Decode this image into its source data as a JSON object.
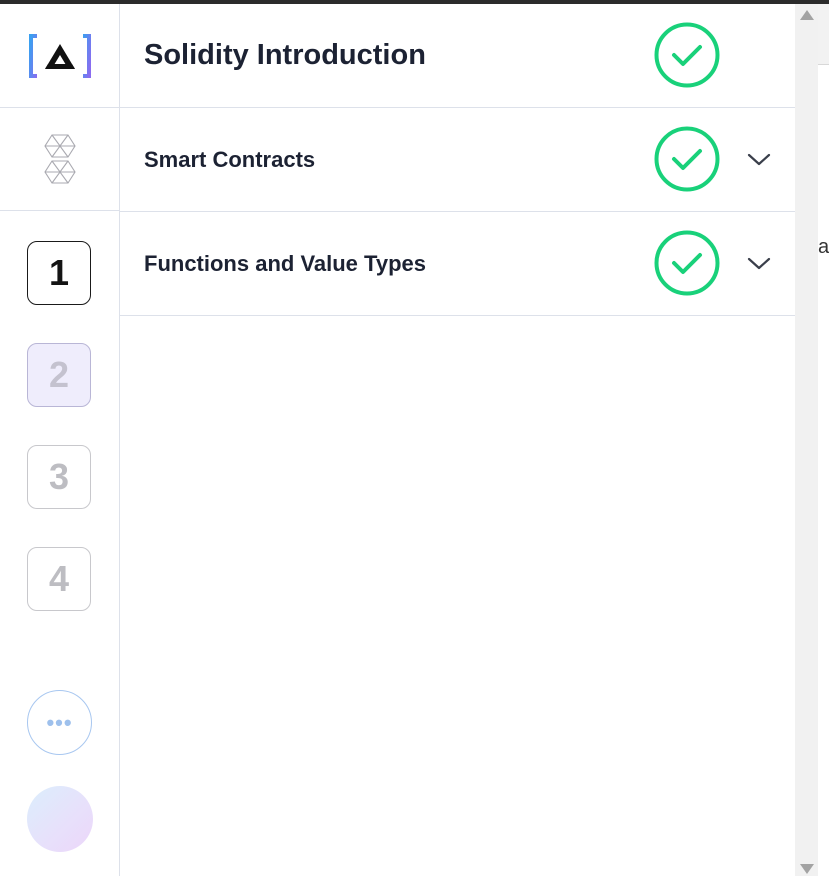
{
  "app": {
    "logo_icon": "alchemy-bracket-logo",
    "hex_icon": "hexagon-triangles-icon"
  },
  "steps": [
    {
      "label": "1",
      "state": "active"
    },
    {
      "label": "2",
      "state": "current"
    },
    {
      "label": "3",
      "state": "inactive"
    },
    {
      "label": "4",
      "state": "inactive"
    }
  ],
  "more_button": {
    "label": "•••"
  },
  "course": {
    "title": "Solidity Introduction",
    "completed": true
  },
  "sections": [
    {
      "title": "Smart Contracts",
      "completed": true,
      "expandable": true
    },
    {
      "title": "Functions and Value Types",
      "completed": true,
      "expandable": true
    }
  ],
  "background_peek": {
    "letter": "a"
  },
  "colors": {
    "check_green": "#19d17a",
    "text_dark": "#1c2233",
    "divider": "#dde1ea",
    "logo_blue": "#3aa0f0",
    "logo_purple": "#8a6cf0"
  }
}
